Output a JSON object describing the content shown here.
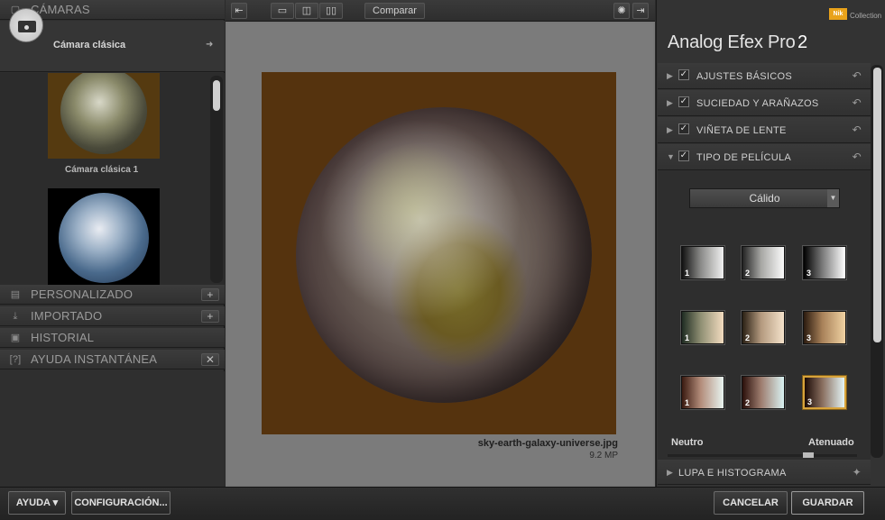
{
  "left_panel": {
    "cameras_title": "CÁMARAS",
    "camera_name": "Cámara clásica",
    "thumb1_label": "Cámara clásica 1",
    "sections": [
      {
        "label": "PERSONALIZADO",
        "button": "+"
      },
      {
        "label": "IMPORTADO",
        "button": "+"
      },
      {
        "label": "HISTORIAL",
        "button": ""
      },
      {
        "label": "AYUDA INSTANTÁNEA",
        "button": "✕"
      }
    ]
  },
  "toolbar": {
    "compare_label": "Comparar"
  },
  "image": {
    "file_name": "sky-earth-galaxy-universe.jpg",
    "megapixels": "9.2 MP"
  },
  "right_panel": {
    "brand_badge": "Nik",
    "brand_collection": "Collection",
    "app_title": "Analog Efex Pro",
    "app_version": "2",
    "sections": [
      {
        "label": "AJUSTES BÁSICOS",
        "checked": true,
        "expanded": false
      },
      {
        "label": "SUCIEDAD Y ARAÑAZOS",
        "checked": true,
        "expanded": false
      },
      {
        "label": "VIÑETA DE LENTE",
        "checked": true,
        "expanded": false
      },
      {
        "label": "TIPO DE PELÍCULA",
        "checked": true,
        "expanded": true
      }
    ],
    "film_type": {
      "selected": "Cálido",
      "swatches": [
        {
          "num": "1",
          "selected": false
        },
        {
          "num": "2",
          "selected": false
        },
        {
          "num": "3",
          "selected": false
        },
        {
          "num": "1",
          "selected": false
        },
        {
          "num": "2",
          "selected": false
        },
        {
          "num": "3",
          "selected": false
        },
        {
          "num": "1",
          "selected": false
        },
        {
          "num": "2",
          "selected": false
        },
        {
          "num": "3",
          "selected": true
        }
      ],
      "slider_left": "Neutro",
      "slider_right": "Atenuado"
    },
    "loupe_label": "LUPA E HISTOGRAMA"
  },
  "bottom_bar": {
    "help_label": "AYUDA",
    "settings_label": "CONFIGURACIÓN...",
    "cancel_label": "CANCELAR",
    "save_label": "GUARDAR"
  }
}
